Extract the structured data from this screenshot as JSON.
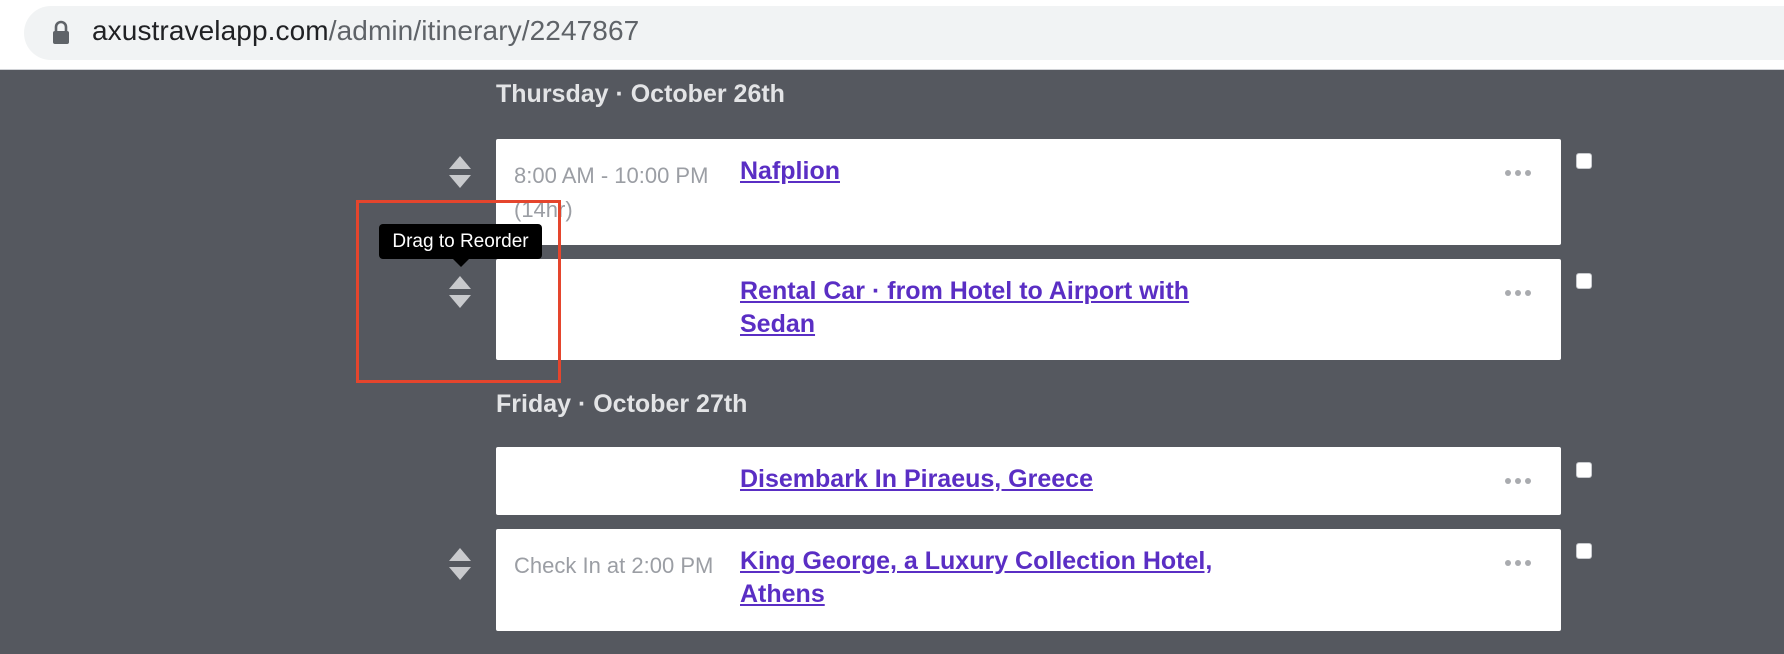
{
  "browser": {
    "url_host": "axustravelapp.com",
    "url_path": "/admin/itinerary/2247867",
    "lock_icon": "lock-icon"
  },
  "tooltip": {
    "text": "Drag to Reorder"
  },
  "days": [
    {
      "header": "Thursday · October 26th",
      "items": [
        {
          "time": "8:00 AM - 10:00 PM (14hr)",
          "title": "Nafplion"
        },
        {
          "time": "",
          "title": "Rental Car · from Hotel to Airport with Sedan"
        }
      ]
    },
    {
      "header": "Friday · October 27th",
      "items": [
        {
          "time": "",
          "title": "Disembark In Piraeus, Greece"
        },
        {
          "time": "Check In at 2:00 PM",
          "title": "King George, a Luxury Collection Hotel, Athens"
        }
      ]
    }
  ],
  "colors": {
    "background": "#55585f",
    "link": "#5a2ec4",
    "highlight": "#e5452d"
  },
  "icons": {
    "drag_handle": "drag-handle-icon",
    "more": "more-options-icon",
    "checkbox": "checkbox"
  }
}
